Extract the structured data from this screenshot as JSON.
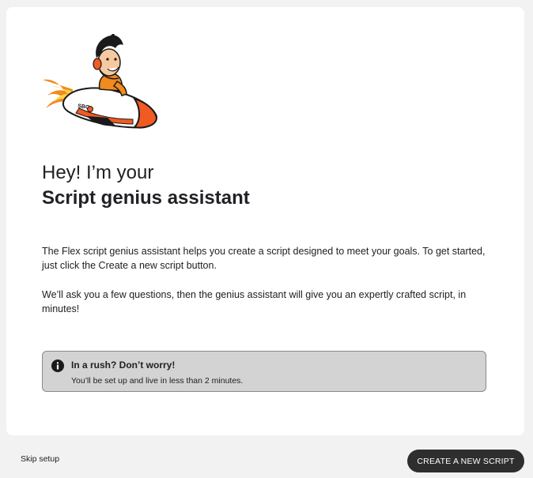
{
  "intro": {
    "headline": "Hey! I’m your",
    "title": "Script genius assistant"
  },
  "body": {
    "paragraph1": "The Flex script genius assistant helps you create a script designed to meet your goals. To get started, just click the Create a new script button.",
    "paragraph2": "We’ll ask you a few questions, then the genius assistant will give you an expertly crafted script, in minutes!"
  },
  "notice": {
    "icon": "info-icon",
    "title": "In a rush? Don’t worry!",
    "text": "You’ll be set up and live in less than 2 minutes."
  },
  "mascot": {
    "icon": "rocket-mascot-illustration",
    "rocket_label": "SBG"
  },
  "footer": {
    "skip_label": "Skip setup",
    "create_label": "CREATE A NEW SCRIPT"
  },
  "colors": {
    "accent_orange": "#f15a22",
    "button_dark": "#2e2e2e",
    "notice_bg": "#d3d3d3"
  }
}
